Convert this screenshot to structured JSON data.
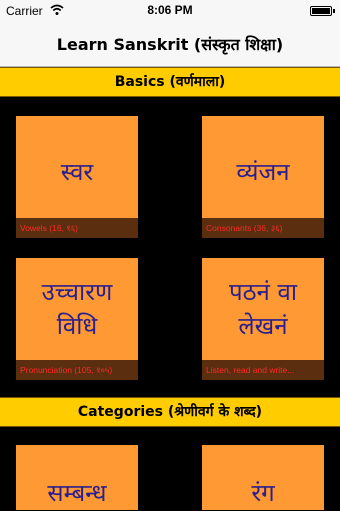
{
  "status_bar": {
    "carrier": "Carrier",
    "time": "8:06 PM"
  },
  "nav": {
    "title": "Learn Sanskrit (संस्कृत शिक्षा)"
  },
  "sections": [
    {
      "title": "Basics (वर्णमाला)"
    },
    {
      "title": "Categories (श्रेणीवर्ग के शब्द)"
    }
  ],
  "tiles": [
    {
      "script": "स्वर",
      "caption": "Vowels (16, १६)"
    },
    {
      "script": "व्यंजन",
      "caption": "Consonants (36, ३६)"
    },
    {
      "script_line1": "उच्चारण",
      "script_line2": "विधि",
      "caption": "Pronunciation (105, १०५)"
    },
    {
      "script_line1": "पठनं वा",
      "script_line2": "लेखनं",
      "caption": "Listen, read and write..."
    },
    {
      "script": "सम्बन्ध"
    },
    {
      "script": "रंग"
    }
  ]
}
